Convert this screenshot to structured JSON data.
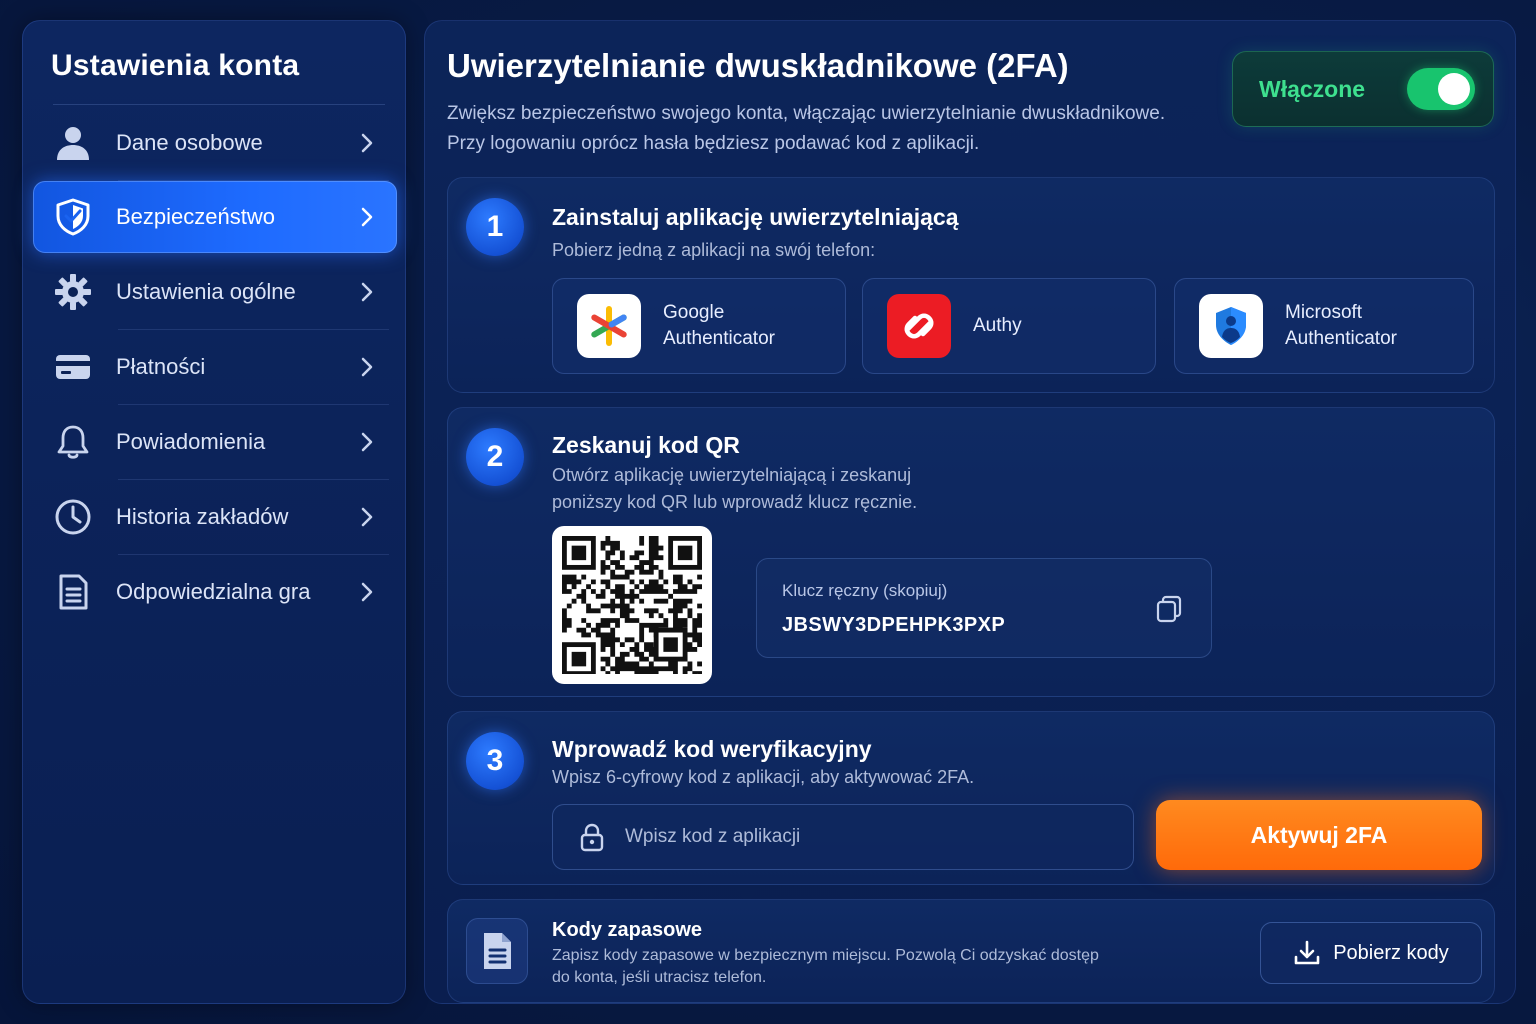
{
  "sidebar": {
    "title": "Ustawienia konta",
    "items": [
      {
        "label": "Dane osobowe",
        "icon": "user-icon",
        "active": false
      },
      {
        "label": "Bezpieczeństwo",
        "icon": "shield-icon",
        "active": true
      },
      {
        "label": "Ustawienia ogólne",
        "icon": "gear-icon",
        "active": false
      },
      {
        "label": "Płatności",
        "icon": "credit-card-icon",
        "active": false
      },
      {
        "label": "Powiadomienia",
        "icon": "bell-icon",
        "active": false
      },
      {
        "label": "Historia zakładów",
        "icon": "clock-icon",
        "active": false
      },
      {
        "label": "Odpowiedzialna gra",
        "icon": "document-icon",
        "active": false
      }
    ]
  },
  "header": {
    "title": "Uwierzytelnianie dwuskładnikowe (2FA)",
    "description_line1": "Zwiększ bezpieczeństwo swojego konta, włączając uwierzytelnianie dwuskładnikowe.",
    "description_line2": "Przy logowaniu oprócz hasła będziesz podawać kod z aplikacji.",
    "toggle_label": "Włączone",
    "toggle_on": true
  },
  "step1": {
    "number": "1",
    "title": "Zainstaluj aplikację uwierzytelniającą",
    "subtitle": "Pobierz jedną z aplikacji na swój telefon:",
    "apps": [
      {
        "name_line1": "Google",
        "name_line2": "Authenticator",
        "icon": "google-authenticator-icon"
      },
      {
        "name_line1": "Authy",
        "name_line2": "",
        "icon": "authy-icon"
      },
      {
        "name_line1": "Microsoft",
        "name_line2": "Authenticator",
        "icon": "microsoft-authenticator-icon"
      }
    ]
  },
  "step2": {
    "number": "2",
    "title": "Zeskanuj kod QR",
    "subtitle_line1": "Otwórz aplikację uwierzytelniającą i zeskanuj",
    "subtitle_line2": "poniższy kod QR lub wprowadź klucz ręcznie.",
    "key_label": "Klucz ręczny (skopiuj)",
    "key_value": "JBSWY3DPEHPK3PXP"
  },
  "step3": {
    "number": "3",
    "title": "Wprowadź kod weryfikacyjny",
    "subtitle": "Wpisz 6-cyfrowy kod z aplikacji, aby aktywować 2FA.",
    "input_placeholder": "Wpisz kod z aplikacji",
    "input_value": "",
    "button_label": "Aktywuj 2FA"
  },
  "backup": {
    "title": "Kody zapasowe",
    "description_line1": "Zapisz kody zapasowe w bezpiecznym miejscu. Pozwolą Ci odzyskać dostęp",
    "description_line2": "do konta, jeśli utracisz telefon.",
    "button_label": "Pobierz kody"
  },
  "colors": {
    "accent": "#1e6bff",
    "toggle_on": "#18c46e",
    "activate_button": "#ff7412",
    "background": "#081b45"
  }
}
